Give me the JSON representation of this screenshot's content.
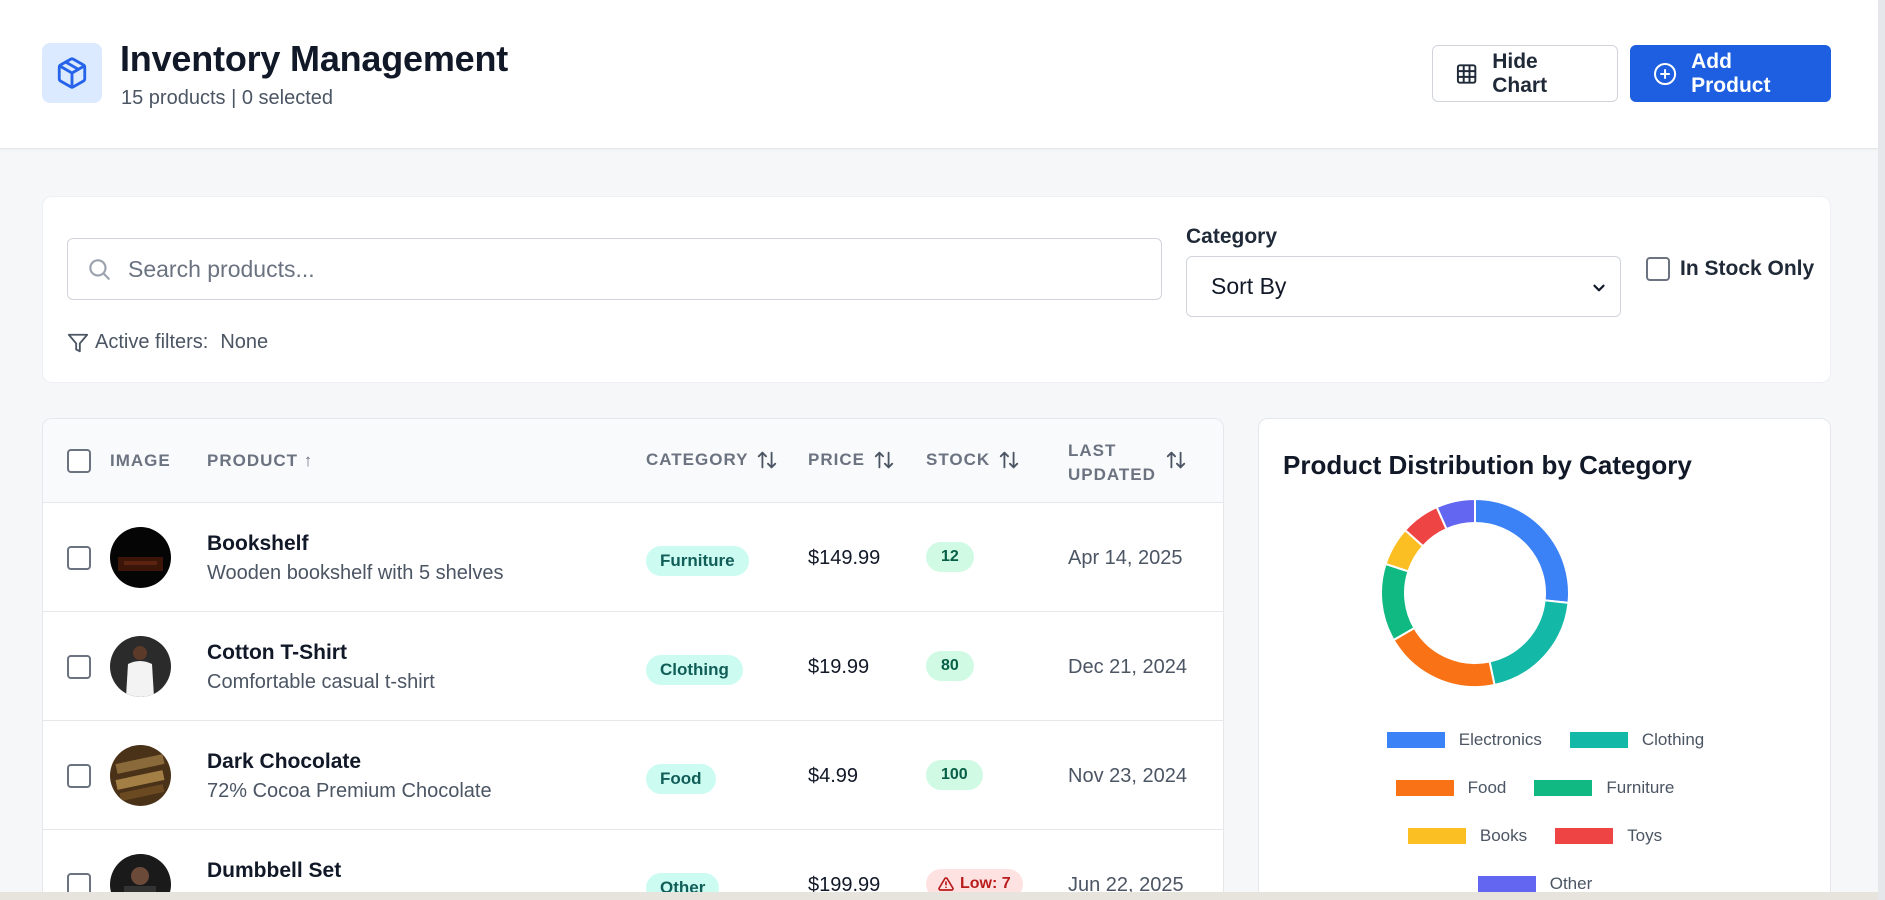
{
  "header": {
    "title": "Inventory Management",
    "subtitle": "15 products | 0 selected",
    "hide_chart_label": "Hide Chart",
    "add_product_label": "Add Product"
  },
  "filters": {
    "search_placeholder": "Search products...",
    "search_value": "",
    "active_filters_label": "Active filters:",
    "active_filters_value": "None",
    "category_label": "Category",
    "sort_selected": "Sort By",
    "in_stock_label": "In Stock Only",
    "in_stock_checked": false
  },
  "table": {
    "headers": {
      "image": "IMAGE",
      "product": "PRODUCT ↑",
      "category": "CATEGORY",
      "price": "PRICE",
      "stock": "STOCK",
      "updated_line1": "LAST",
      "updated_line2": "UPDATED"
    },
    "rows": [
      {
        "name": "Bookshelf",
        "description": "Wooden bookshelf with 5 shelves",
        "category": "Furniture",
        "price": "$149.99",
        "stock": "12",
        "updated": "Apr 14, 2025",
        "low": false
      },
      {
        "name": "Cotton T-Shirt",
        "description": "Comfortable casual t-shirt",
        "category": "Clothing",
        "price": "$19.99",
        "stock": "80",
        "updated": "Dec 21, 2024",
        "low": false
      },
      {
        "name": "Dark Chocolate",
        "description": "72% Cocoa Premium Chocolate",
        "category": "Food",
        "price": "$4.99",
        "stock": "100",
        "updated": "Nov 23, 2024",
        "low": false
      },
      {
        "name": "Dumbbell Set",
        "description": "",
        "category": "Other",
        "price": "$199.99",
        "stock": "Low: 7",
        "updated": "Jun 22, 2025",
        "low": true
      }
    ]
  },
  "chart": {
    "title": "Product Distribution by Category",
    "legend": [
      {
        "label": "Electronics",
        "color": "#3b82f6"
      },
      {
        "label": "Clothing",
        "color": "#14b8a6"
      },
      {
        "label": "Food",
        "color": "#f97316"
      },
      {
        "label": "Furniture",
        "color": "#10b981"
      },
      {
        "label": "Books",
        "color": "#fbbf24"
      },
      {
        "label": "Toys",
        "color": "#ef4444"
      },
      {
        "label": "Other",
        "color": "#6366f1"
      }
    ]
  },
  "chart_data": {
    "type": "pie",
    "title": "Product Distribution by Category",
    "categories": [
      "Electronics",
      "Clothing",
      "Food",
      "Furniture",
      "Books",
      "Toys",
      "Other"
    ],
    "values": [
      4,
      3,
      3,
      2,
      1,
      1,
      1
    ],
    "colors": [
      "#3b82f6",
      "#14b8a6",
      "#f97316",
      "#10b981",
      "#fbbf24",
      "#ef4444",
      "#6366f1"
    ],
    "donut": true,
    "legend": "bottom"
  },
  "colors": {
    "accent": "#1d5fe0",
    "logo_bg": "#dbeafe",
    "badge_category_bg": "#ccfbf1",
    "badge_stock_bg": "#d1fae5",
    "badge_low_bg": "#fee2e2"
  },
  "icons": {
    "logo": "box-icon",
    "hide_chart": "grid-icon",
    "add_product": "plus-circle-icon",
    "search": "search-icon",
    "filter": "filter-icon",
    "sort": "sort-arrows-icon",
    "low_stock": "warning-icon"
  }
}
